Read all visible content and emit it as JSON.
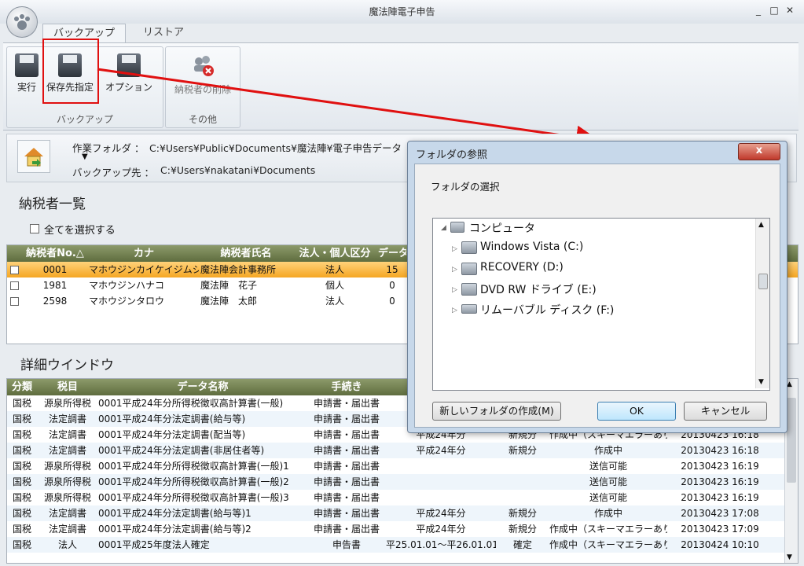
{
  "window": {
    "title": "魔法陣電子申告",
    "min": "_",
    "restore": "□",
    "close": "✕"
  },
  "tabs": [
    {
      "label": "バックアップ"
    },
    {
      "label": "リストア"
    }
  ],
  "ribbon": {
    "backup_group": "バックアップ",
    "other_group": "その他",
    "run": "実行",
    "save_dest": "保存先指定",
    "options": "オプション",
    "delete_taxpayer": "納税者の削除"
  },
  "info": {
    "work_folder_label": "作業フォルダ ：",
    "work_folder": "C:¥Users¥Public¥Documents¥魔法陣¥電子申告データ",
    "backup_label": "バックアップ先 ：",
    "backup_dest": "C:¥Users¥nakatani¥Documents"
  },
  "taxpayers": {
    "title": "納税者一覧",
    "select_all": "全てを選択する",
    "headers": [
      "納税者No.△",
      "カナ",
      "納税者氏名",
      "法人・個人区分",
      "データ"
    ],
    "rows": [
      {
        "no": "0001",
        "kana": "マホウジンカイケイジムショ",
        "name": "魔法陣会計事務所",
        "type": "法人",
        "data": "15"
      },
      {
        "no": "1981",
        "kana": "マホウジンハナコ",
        "name": "魔法陣　花子",
        "type": "個人",
        "data": "0"
      },
      {
        "no": "2598",
        "kana": "マホウジンタロウ",
        "name": "魔法陣　太郎",
        "type": "法人",
        "data": "0"
      }
    ]
  },
  "detail": {
    "title": "詳細ウインドウ",
    "headers": [
      "分類",
      "税目",
      "データ名称",
      "手続き"
    ],
    "rows": [
      {
        "c1": "国税",
        "c2": "源泉所得税",
        "c3": "0001平成24年分所得税徴収高計算書(一般)",
        "c4": "申請書・届出書",
        "c5": "",
        "c6": "",
        "c7": "",
        "c8": ""
      },
      {
        "c1": "国税",
        "c2": "法定調書",
        "c3": "0001平成24年分法定調書(給与等)",
        "c4": "申請書・届出書",
        "c5": "",
        "c6": "",
        "c7": "",
        "c8": ""
      },
      {
        "c1": "国税",
        "c2": "法定調書",
        "c3": "0001平成24年分法定調書(配当等)",
        "c4": "申請書・届出書",
        "c5": "平成24年分",
        "c6": "新規分",
        "c7": "作成中（スキーマエラーあり）",
        "c8": "20130423 16:18"
      },
      {
        "c1": "国税",
        "c2": "法定調書",
        "c3": "0001平成24年分法定調書(非居住者等)",
        "c4": "申請書・届出書",
        "c5": "平成24年分",
        "c6": "新規分",
        "c7": "作成中",
        "c8": "20130423 16:18"
      },
      {
        "c1": "国税",
        "c2": "源泉所得税",
        "c3": "0001平成24年分所得税徴収高計算書(一般)1",
        "c4": "申請書・届出書",
        "c5": "",
        "c6": "",
        "c7": "送信可能",
        "c8": "20130423 16:19"
      },
      {
        "c1": "国税",
        "c2": "源泉所得税",
        "c3": "0001平成24年分所得税徴収高計算書(一般)2",
        "c4": "申請書・届出書",
        "c5": "",
        "c6": "",
        "c7": "送信可能",
        "c8": "20130423 16:19"
      },
      {
        "c1": "国税",
        "c2": "源泉所得税",
        "c3": "0001平成24年分所得税徴収高計算書(一般)3",
        "c4": "申請書・届出書",
        "c5": "",
        "c6": "",
        "c7": "送信可能",
        "c8": "20130423 16:19"
      },
      {
        "c1": "国税",
        "c2": "法定調書",
        "c3": "0001平成24年分法定調書(給与等)1",
        "c4": "申請書・届出書",
        "c5": "平成24年分",
        "c6": "新規分",
        "c7": "作成中",
        "c8": "20130423 17:08"
      },
      {
        "c1": "国税",
        "c2": "法定調書",
        "c3": "0001平成24年分法定調書(給与等)2",
        "c4": "申請書・届出書",
        "c5": "平成24年分",
        "c6": "新規分",
        "c7": "作成中（スキーマエラーあり）",
        "c8": "20130423 17:09"
      },
      {
        "c1": "国税",
        "c2": "法人",
        "c3": "0001平成25年度法人確定",
        "c4": "申告書",
        "c5": "平25.01.01〜平26.01.01",
        "c6": "確定",
        "c7": "作成中（スキーマエラーあり）",
        "c8": "20130424 10:10"
      }
    ]
  },
  "dialog": {
    "title": "フォルダの参照",
    "close": "x",
    "prompt": "フォルダの選択",
    "tree": [
      {
        "label": "コンピュータ"
      },
      {
        "label": "Windows Vista (C:)"
      },
      {
        "label": "RECOVERY (D:)"
      },
      {
        "label": "DVD RW ドライブ (E:)"
      },
      {
        "label": "リムーバブル ディスク (F:)"
      }
    ],
    "new_folder": "新しいフォルダの作成(M)",
    "ok": "OK",
    "cancel": "キャンセル"
  },
  "colors": {
    "highlight": "#e01010",
    "selected_row": "#f5a623",
    "grid_header": "#6b7a4a"
  }
}
